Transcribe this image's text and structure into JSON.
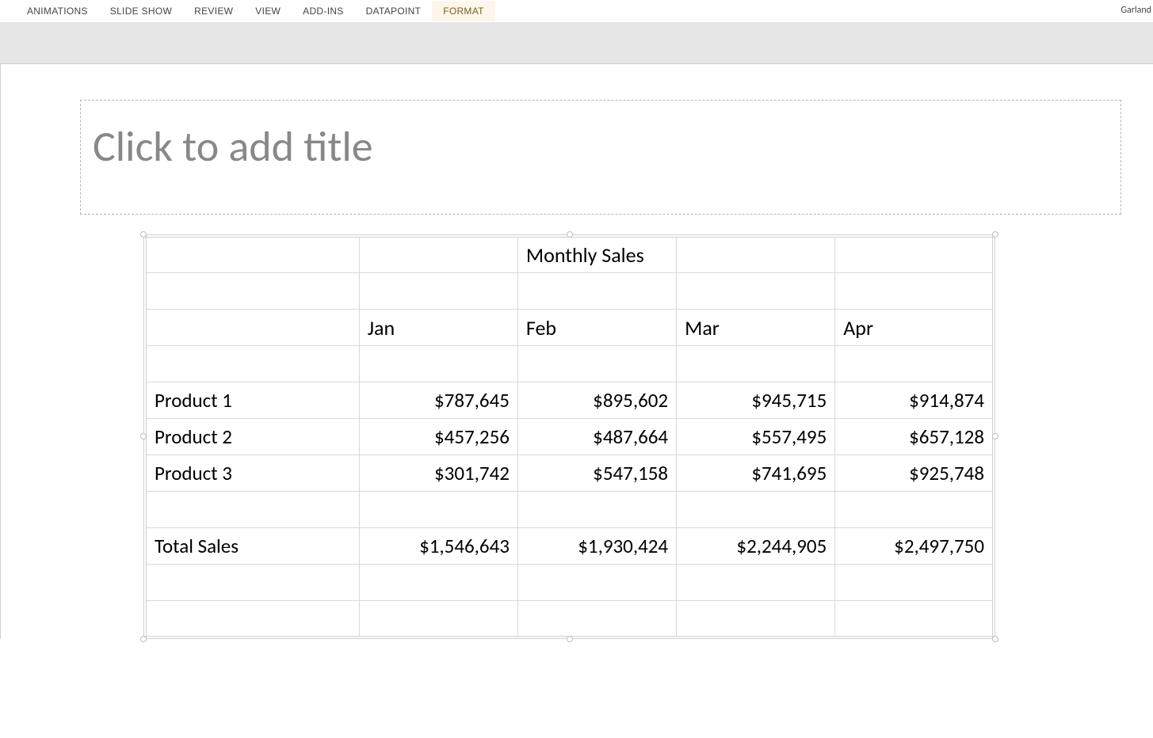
{
  "ribbon": {
    "tabs": [
      {
        "label": "ANIMATIONS",
        "active": false
      },
      {
        "label": "SLIDE SHOW",
        "active": false
      },
      {
        "label": "REVIEW",
        "active": false
      },
      {
        "label": "VIEW",
        "active": false
      },
      {
        "label": "ADD-INS",
        "active": false
      },
      {
        "label": "DATAPOINT",
        "active": false
      },
      {
        "label": "FORMAT",
        "active": true
      }
    ],
    "user": "Garland"
  },
  "slide": {
    "title_placeholder": "Click to add title"
  },
  "table": {
    "title": "Monthly Sales",
    "months": [
      "Jan",
      "Feb",
      "Mar",
      "Apr"
    ],
    "rows": [
      {
        "label": "Product 1",
        "values": [
          "$787,645",
          "$895,602",
          "$945,715",
          "$914,874"
        ]
      },
      {
        "label": "Product 2",
        "values": [
          "$457,256",
          "$487,664",
          "$557,495",
          "$657,128"
        ]
      },
      {
        "label": "Product 3",
        "values": [
          "$301,742",
          "$547,158",
          "$741,695",
          "$925,748"
        ]
      }
    ],
    "total": {
      "label": "Total Sales",
      "values": [
        "$1,546,643",
        "$1,930,424",
        "$2,244,905",
        "$2,497,750"
      ]
    }
  },
  "chart_data": {
    "type": "table",
    "title": "Monthly Sales",
    "categories": [
      "Jan",
      "Feb",
      "Mar",
      "Apr"
    ],
    "series": [
      {
        "name": "Product 1",
        "values": [
          787645,
          895602,
          945715,
          914874
        ]
      },
      {
        "name": "Product 2",
        "values": [
          457256,
          487664,
          557495,
          657128
        ]
      },
      {
        "name": "Product 3",
        "values": [
          301742,
          547158,
          741695,
          925748
        ]
      },
      {
        "name": "Total Sales",
        "values": [
          1546643,
          1930424,
          2244905,
          2497750
        ]
      }
    ]
  }
}
